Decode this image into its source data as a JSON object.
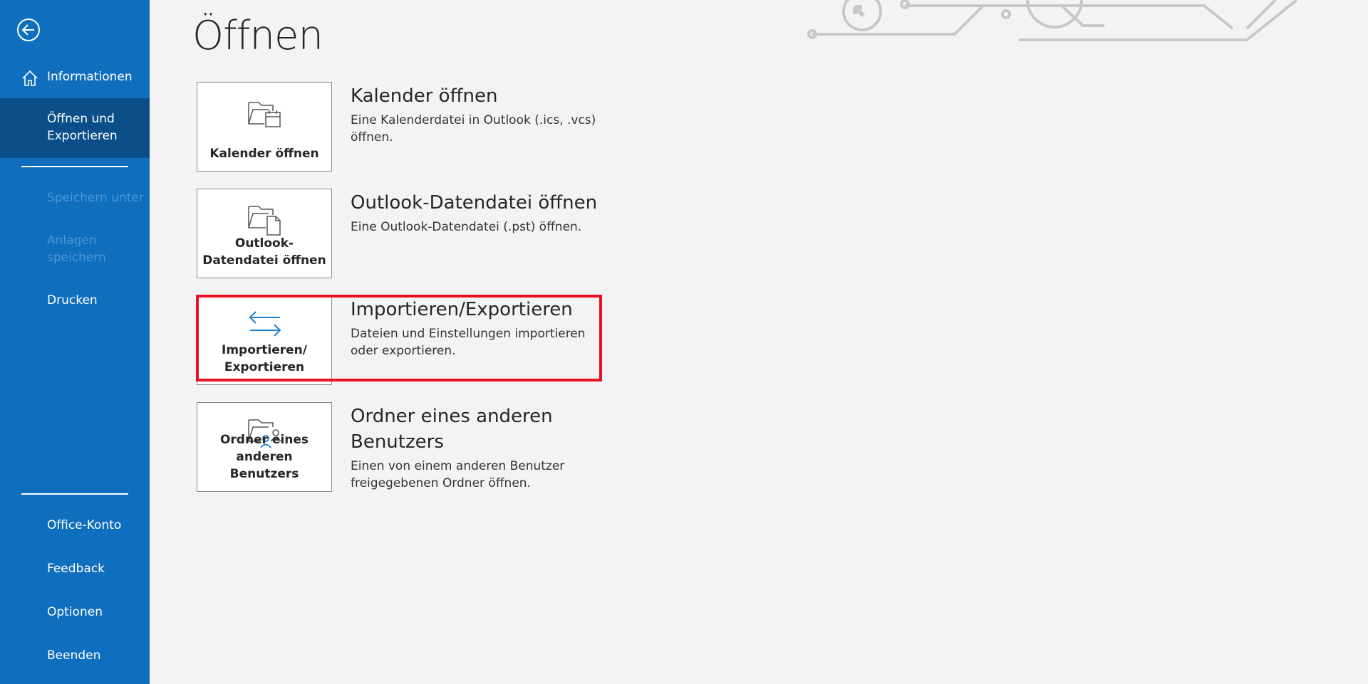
{
  "sidebar": {
    "back_label": "Zurück",
    "items": [
      {
        "label": "Informationen"
      },
      {
        "label": "Öffnen und Exportieren"
      },
      {
        "label": "Speichern unter"
      },
      {
        "label": "Anlagen speichern"
      },
      {
        "label": "Drucken"
      },
      {
        "label": "Office-Konto"
      },
      {
        "label": "Feedback"
      },
      {
        "label": "Optionen"
      },
      {
        "label": "Beenden"
      }
    ],
    "colors": {
      "background": "#106ebe",
      "selected": "#0a4f8a",
      "disabled_text": "#4a95d6"
    }
  },
  "main": {
    "title": "Öffnen",
    "options": [
      {
        "tile_label": "Kalender öffnen",
        "title": "Kalender öffnen",
        "description": "Eine Kalenderdatei in Outlook (.ics, .vcs) öffnen.",
        "icon": "folder-calendar-icon"
      },
      {
        "tile_label": "Outlook-Datendatei öffnen",
        "title": "Outlook-Datendatei öffnen",
        "description": "Eine Outlook-Datendatei (.pst) öffnen.",
        "icon": "folder-file-icon"
      },
      {
        "tile_label": "Importieren/ Exportieren",
        "title": "Importieren/Exportieren",
        "description": "Dateien und Einstellungen importieren oder exportieren.",
        "icon": "import-export-arrows-icon"
      },
      {
        "tile_label": "Ordner eines anderen Benutzers",
        "title": "Ordner eines anderen Benutzers",
        "description": "Einen von einem anderen Benutzer freigegebenen Ordner öffnen.",
        "icon": "folder-users-icon"
      }
    ],
    "highlight_color": "#e81123"
  }
}
